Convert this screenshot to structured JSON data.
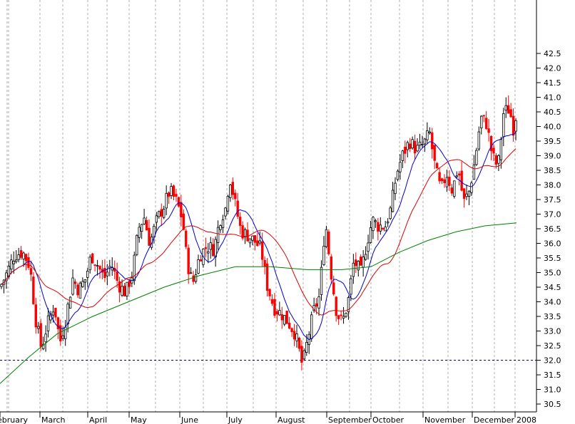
{
  "chart_data": {
    "type": "candlestick",
    "title": "",
    "xlabel": "",
    "ylabel": "",
    "ylim": [
      30.3,
      42.7
    ],
    "y_ticks": [
      30.5,
      31.0,
      31.5,
      32.0,
      32.5,
      33.0,
      33.5,
      34.0,
      34.5,
      35.0,
      35.5,
      36.0,
      36.5,
      37.0,
      37.5,
      38.0,
      38.5,
      39.0,
      39.5,
      40.0,
      40.5,
      41.0,
      41.5,
      42.0,
      42.5
    ],
    "y_tick_labels": [
      "30.5",
      "31.0",
      "31.5",
      "32.0",
      "32.5",
      "33.0",
      "33.5",
      "34.0",
      "34.5",
      "35.0",
      "35.5",
      "36.0",
      "36.5",
      "37.0",
      "37.5",
      "38.0",
      "38.5",
      "39.0",
      "39.5",
      "40.0",
      "40.5",
      "41.0",
      "41.5",
      "42.0",
      "42.5"
    ],
    "month_labels": [
      "ebruary",
      "March",
      "April",
      "May",
      "June",
      "July",
      "August",
      "September",
      "October",
      "November",
      "December",
      "2008"
    ],
    "reference_line": 32.0,
    "grid": true,
    "colors": {
      "up": "#000000",
      "down": "#ff0000",
      "ma_short": "#0000cc",
      "ma_mid": "#dd0000",
      "ma_long": "#008000",
      "grid": "#999999",
      "reference": "#000080"
    },
    "series": [
      {
        "name": "",
        "key": "ma_short"
      },
      {
        "name": "",
        "key": "ma_mid"
      },
      {
        "name": "",
        "key": "ma_long"
      }
    ]
  }
}
